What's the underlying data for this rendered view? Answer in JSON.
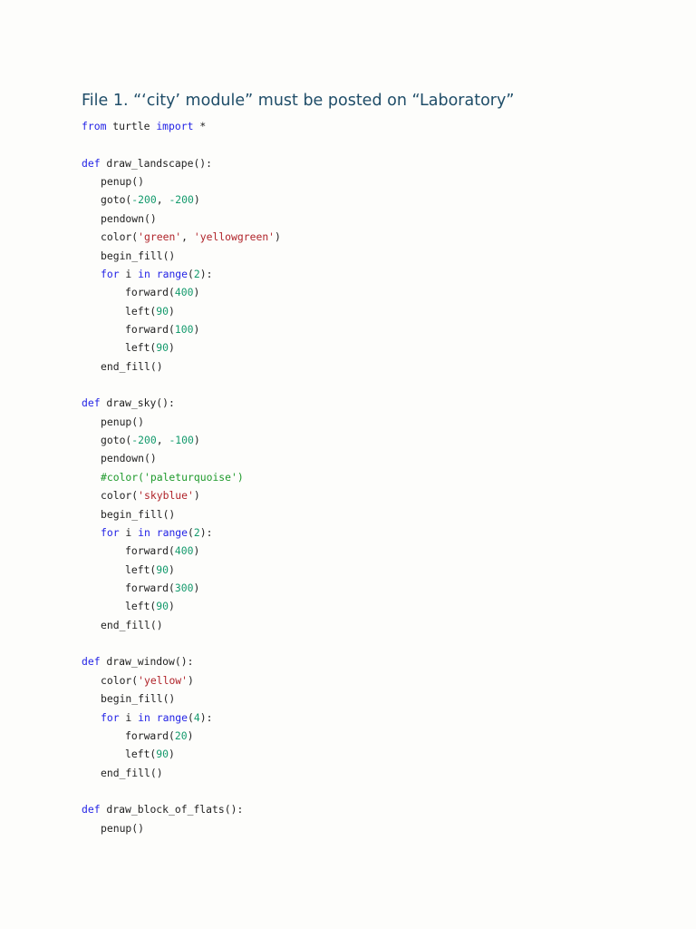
{
  "title": "File 1. “‘city’ module” must be posted on “Laboratory”",
  "colors": {
    "keyword": "#2323e6",
    "number": "#139a6c",
    "string": "#b0242a",
    "comment": "#1f9a2c",
    "title": "#1f4d68"
  },
  "code_lines": [
    {
      "indent": 0,
      "tokens": [
        [
          "kw",
          "from"
        ],
        [
          "txt",
          " turtle "
        ],
        [
          "kw",
          "import"
        ],
        [
          "txt",
          " *"
        ]
      ]
    },
    {
      "indent": 0,
      "tokens": []
    },
    {
      "indent": 0,
      "tokens": [
        [
          "kw",
          "def"
        ],
        [
          "txt",
          " draw_landscape():"
        ]
      ]
    },
    {
      "indent": 1,
      "tokens": [
        [
          "txt",
          "penup()"
        ]
      ]
    },
    {
      "indent": 1,
      "tokens": [
        [
          "txt",
          "goto("
        ],
        [
          "num",
          "-200"
        ],
        [
          "txt",
          ", "
        ],
        [
          "num",
          "-200"
        ],
        [
          "txt",
          ")"
        ]
      ]
    },
    {
      "indent": 1,
      "tokens": [
        [
          "txt",
          "pendown()"
        ]
      ]
    },
    {
      "indent": 1,
      "tokens": [
        [
          "txt",
          "color("
        ],
        [
          "str",
          "'green'"
        ],
        [
          "txt",
          ", "
        ],
        [
          "str",
          "'yellowgreen'"
        ],
        [
          "txt",
          ")"
        ]
      ]
    },
    {
      "indent": 1,
      "tokens": [
        [
          "txt",
          "begin_fill()"
        ]
      ]
    },
    {
      "indent": 1,
      "tokens": [
        [
          "kw",
          "for"
        ],
        [
          "txt",
          " i "
        ],
        [
          "kw",
          "in"
        ],
        [
          "txt",
          " "
        ],
        [
          "kw",
          "range"
        ],
        [
          "txt",
          "("
        ],
        [
          "num",
          "2"
        ],
        [
          "txt",
          "):"
        ]
      ]
    },
    {
      "indent": 2,
      "tokens": [
        [
          "txt",
          "forward("
        ],
        [
          "num",
          "400"
        ],
        [
          "txt",
          ")"
        ]
      ]
    },
    {
      "indent": 2,
      "tokens": [
        [
          "txt",
          "left("
        ],
        [
          "num",
          "90"
        ],
        [
          "txt",
          ")"
        ]
      ]
    },
    {
      "indent": 2,
      "tokens": [
        [
          "txt",
          "forward("
        ],
        [
          "num",
          "100"
        ],
        [
          "txt",
          ")"
        ]
      ]
    },
    {
      "indent": 2,
      "tokens": [
        [
          "txt",
          "left("
        ],
        [
          "num",
          "90"
        ],
        [
          "txt",
          ")"
        ]
      ]
    },
    {
      "indent": 1,
      "tokens": [
        [
          "txt",
          "end_fill()"
        ]
      ]
    },
    {
      "indent": 0,
      "tokens": []
    },
    {
      "indent": 0,
      "tokens": [
        [
          "kw",
          "def"
        ],
        [
          "txt",
          " draw_sky():"
        ]
      ]
    },
    {
      "indent": 1,
      "tokens": [
        [
          "txt",
          "penup()"
        ]
      ]
    },
    {
      "indent": 1,
      "tokens": [
        [
          "txt",
          "goto("
        ],
        [
          "num",
          "-200"
        ],
        [
          "txt",
          ", "
        ],
        [
          "num",
          "-100"
        ],
        [
          "txt",
          ")"
        ]
      ]
    },
    {
      "indent": 1,
      "tokens": [
        [
          "txt",
          "pendown()"
        ]
      ]
    },
    {
      "indent": 1,
      "tokens": [
        [
          "com",
          "#color('paleturquoise')"
        ]
      ]
    },
    {
      "indent": 1,
      "tokens": [
        [
          "txt",
          "color("
        ],
        [
          "str",
          "'skyblue'"
        ],
        [
          "txt",
          ")"
        ]
      ]
    },
    {
      "indent": 1,
      "tokens": [
        [
          "txt",
          "begin_fill()"
        ]
      ]
    },
    {
      "indent": 1,
      "tokens": [
        [
          "kw",
          "for"
        ],
        [
          "txt",
          " i "
        ],
        [
          "kw",
          "in"
        ],
        [
          "txt",
          " "
        ],
        [
          "kw",
          "range"
        ],
        [
          "txt",
          "("
        ],
        [
          "num",
          "2"
        ],
        [
          "txt",
          "):"
        ]
      ]
    },
    {
      "indent": 2,
      "tokens": [
        [
          "txt",
          "forward("
        ],
        [
          "num",
          "400"
        ],
        [
          "txt",
          ")"
        ]
      ]
    },
    {
      "indent": 2,
      "tokens": [
        [
          "txt",
          "left("
        ],
        [
          "num",
          "90"
        ],
        [
          "txt",
          ")"
        ]
      ]
    },
    {
      "indent": 2,
      "tokens": [
        [
          "txt",
          "forward("
        ],
        [
          "num",
          "300"
        ],
        [
          "txt",
          ")"
        ]
      ]
    },
    {
      "indent": 2,
      "tokens": [
        [
          "txt",
          "left("
        ],
        [
          "num",
          "90"
        ],
        [
          "txt",
          ")"
        ]
      ]
    },
    {
      "indent": 1,
      "tokens": [
        [
          "txt",
          "end_fill()"
        ]
      ]
    },
    {
      "indent": 0,
      "tokens": []
    },
    {
      "indent": 0,
      "tokens": [
        [
          "kw",
          "def"
        ],
        [
          "txt",
          " draw_window():"
        ]
      ]
    },
    {
      "indent": 1,
      "tokens": [
        [
          "txt",
          "color("
        ],
        [
          "str",
          "'yellow'"
        ],
        [
          "txt",
          ")"
        ]
      ]
    },
    {
      "indent": 1,
      "tokens": [
        [
          "txt",
          "begin_fill()"
        ]
      ]
    },
    {
      "indent": 1,
      "tokens": [
        [
          "kw",
          "for"
        ],
        [
          "txt",
          " i "
        ],
        [
          "kw",
          "in"
        ],
        [
          "txt",
          " "
        ],
        [
          "kw",
          "range"
        ],
        [
          "txt",
          "("
        ],
        [
          "num",
          "4"
        ],
        [
          "txt",
          "):"
        ]
      ]
    },
    {
      "indent": 2,
      "tokens": [
        [
          "txt",
          "forward("
        ],
        [
          "num",
          "20"
        ],
        [
          "txt",
          ")"
        ]
      ]
    },
    {
      "indent": 2,
      "tokens": [
        [
          "txt",
          "left("
        ],
        [
          "num",
          "90"
        ],
        [
          "txt",
          ")"
        ]
      ]
    },
    {
      "indent": 1,
      "tokens": [
        [
          "txt",
          "end_fill()"
        ]
      ]
    },
    {
      "indent": 0,
      "tokens": []
    },
    {
      "indent": 0,
      "tokens": [
        [
          "kw",
          "def"
        ],
        [
          "txt",
          " draw_block_of_flats():"
        ]
      ]
    },
    {
      "indent": 1,
      "tokens": [
        [
          "txt",
          "penup()"
        ]
      ]
    }
  ]
}
